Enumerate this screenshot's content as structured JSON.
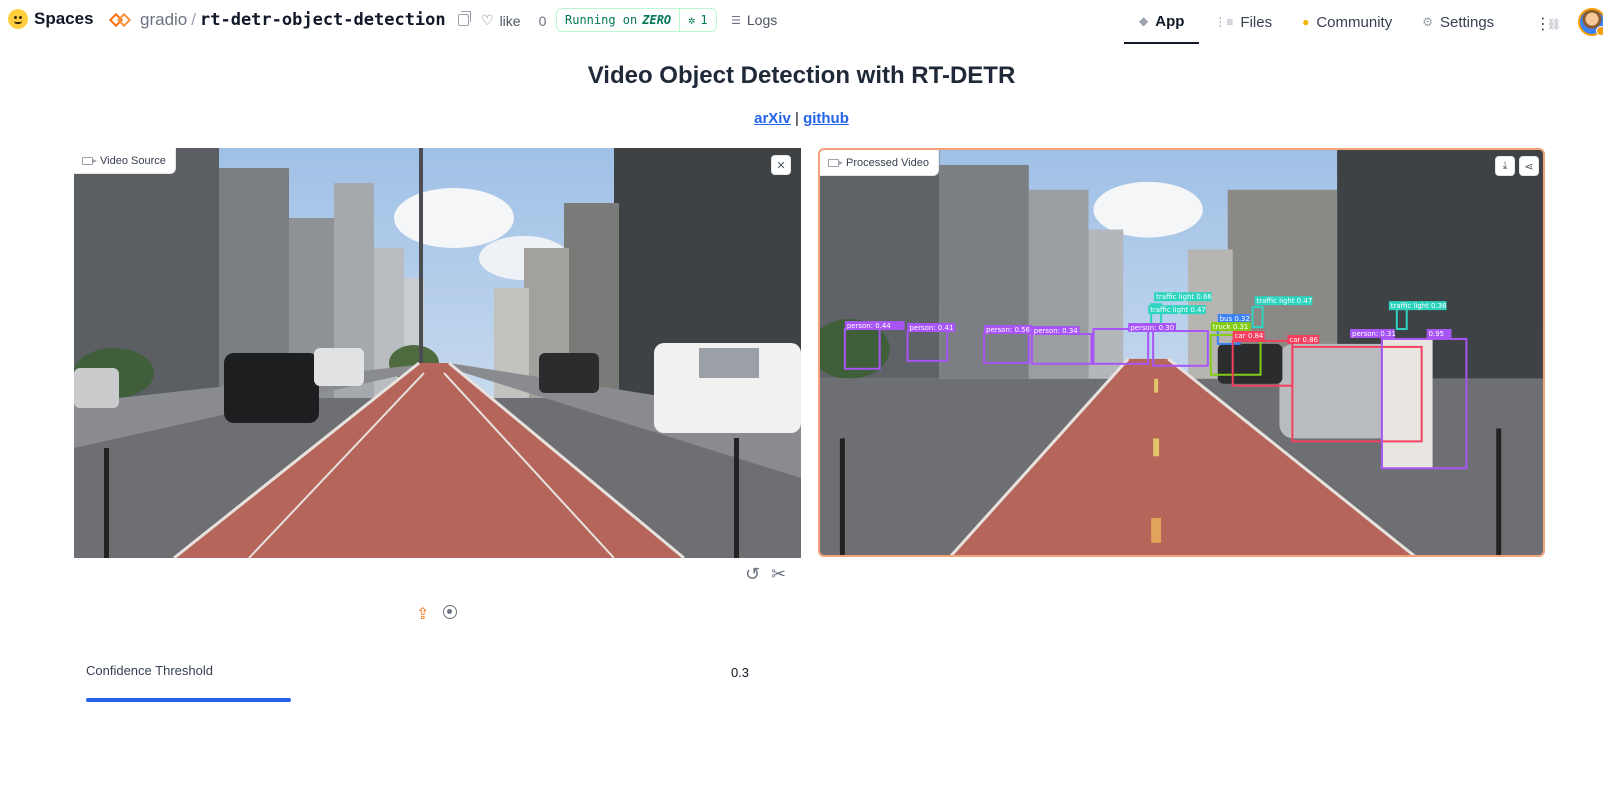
{
  "brand": {
    "name": "Spaces"
  },
  "repo": {
    "org": "gradio",
    "name": "rt-detr-object-detection"
  },
  "like": {
    "label": "like",
    "count": "0"
  },
  "status": {
    "running_prefix": "Running on",
    "running_hardware": "ZERO",
    "replicas": "1"
  },
  "logs": {
    "label": "Logs"
  },
  "nav": [
    {
      "label": "App",
      "icon": "app-icon",
      "active": true
    },
    {
      "label": "Files",
      "icon": "files-icon",
      "active": false
    },
    {
      "label": "Community",
      "icon": "community-icon",
      "active": false
    },
    {
      "label": "Settings",
      "icon": "gear-icon",
      "active": false
    }
  ],
  "page": {
    "title": "Video Object Detection with RT-DETR",
    "link_arxiv": "arXiv",
    "link_separator": "|",
    "link_github": "github"
  },
  "input_video": {
    "label": "Video Source"
  },
  "output_video": {
    "label": "Processed Video",
    "detections": [
      "person: 0.44",
      "person: 0.41",
      "person: 0.56",
      "person: 0.34",
      "person: 0.30",
      "traffic light 0.66",
      "traffic light 0.47",
      "traffic light 0.47",
      "traffic light 0.36",
      "bus 0.32",
      "truck 0.31",
      "car 0.84",
      "car 0.86",
      "person: 0.31",
      "0.95"
    ]
  },
  "slider": {
    "label": "Confidence Threshold",
    "value": "0.3",
    "fill": 0.3
  },
  "colors": {
    "accent": "#f97316",
    "slider": "#2563eb",
    "running": "#047857",
    "link": "#2563eb"
  }
}
